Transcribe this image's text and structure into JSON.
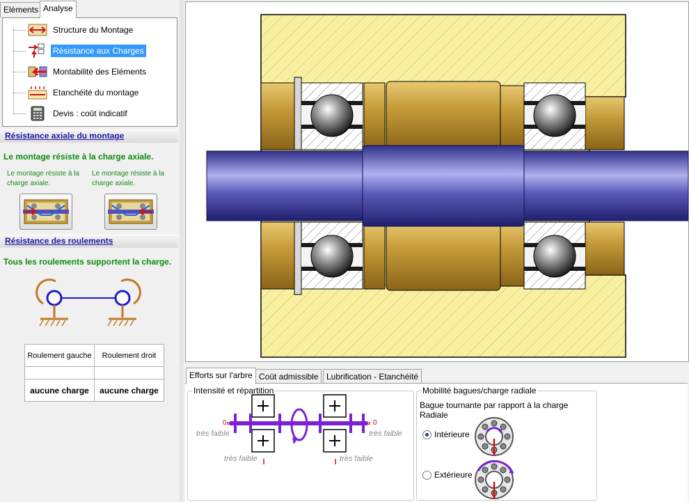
{
  "tabs": {
    "elements": "Eléments",
    "analyse": "Analyse"
  },
  "tree": [
    {
      "label": "Structure du Montage",
      "icon": "structure-icon"
    },
    {
      "label": "Résistance aux Charges",
      "icon": "resistance-icon",
      "selected": true
    },
    {
      "label": "Montabilité des Eléments",
      "icon": "montabilite-icon"
    },
    {
      "label": "Etanchéité du montage",
      "icon": "etancheite-icon"
    },
    {
      "label": "Devis : coût indicatif",
      "icon": "calculator-icon"
    }
  ],
  "axial": {
    "title": "Résistance axiale du montage",
    "status": "Le montage résiste à la charge axiale.",
    "left_note": "Le montage résiste à la charge axiale.",
    "right_note": "Le montage résiste à la charge axiale."
  },
  "roulements": {
    "title": "Résistance des roulements",
    "status": "Tous les roulements supportent la charge.",
    "col_left": "Roulement gauche",
    "col_right": "Roulement droit",
    "val_left": "aucune charge",
    "val_right": "aucune charge"
  },
  "bottom_tabs": [
    "Efforts sur l'arbre",
    "Coût admissible",
    "Lubrification - Etanchéité"
  ],
  "efforts": {
    "group_title": "Intensité et répartition",
    "zero": "0",
    "tres_faible": "très faible"
  },
  "mobilite": {
    "group_title": "Mobilité bagues/charge radiale",
    "subtitle": "Bague tournante par rapport à la charge Radiale",
    "opt_int": "Intérieure",
    "opt_ext": "Extérieure",
    "selected": "Intérieure"
  },
  "colors": {
    "selection": "#3399ff",
    "link": "#1a1aa6",
    "ok_green": "#0a8a0a",
    "shaft": "#4a4aa8",
    "housing": "#f8f0a0",
    "bronze": "#b8912e",
    "arrow_purple": "#7b22d8"
  }
}
